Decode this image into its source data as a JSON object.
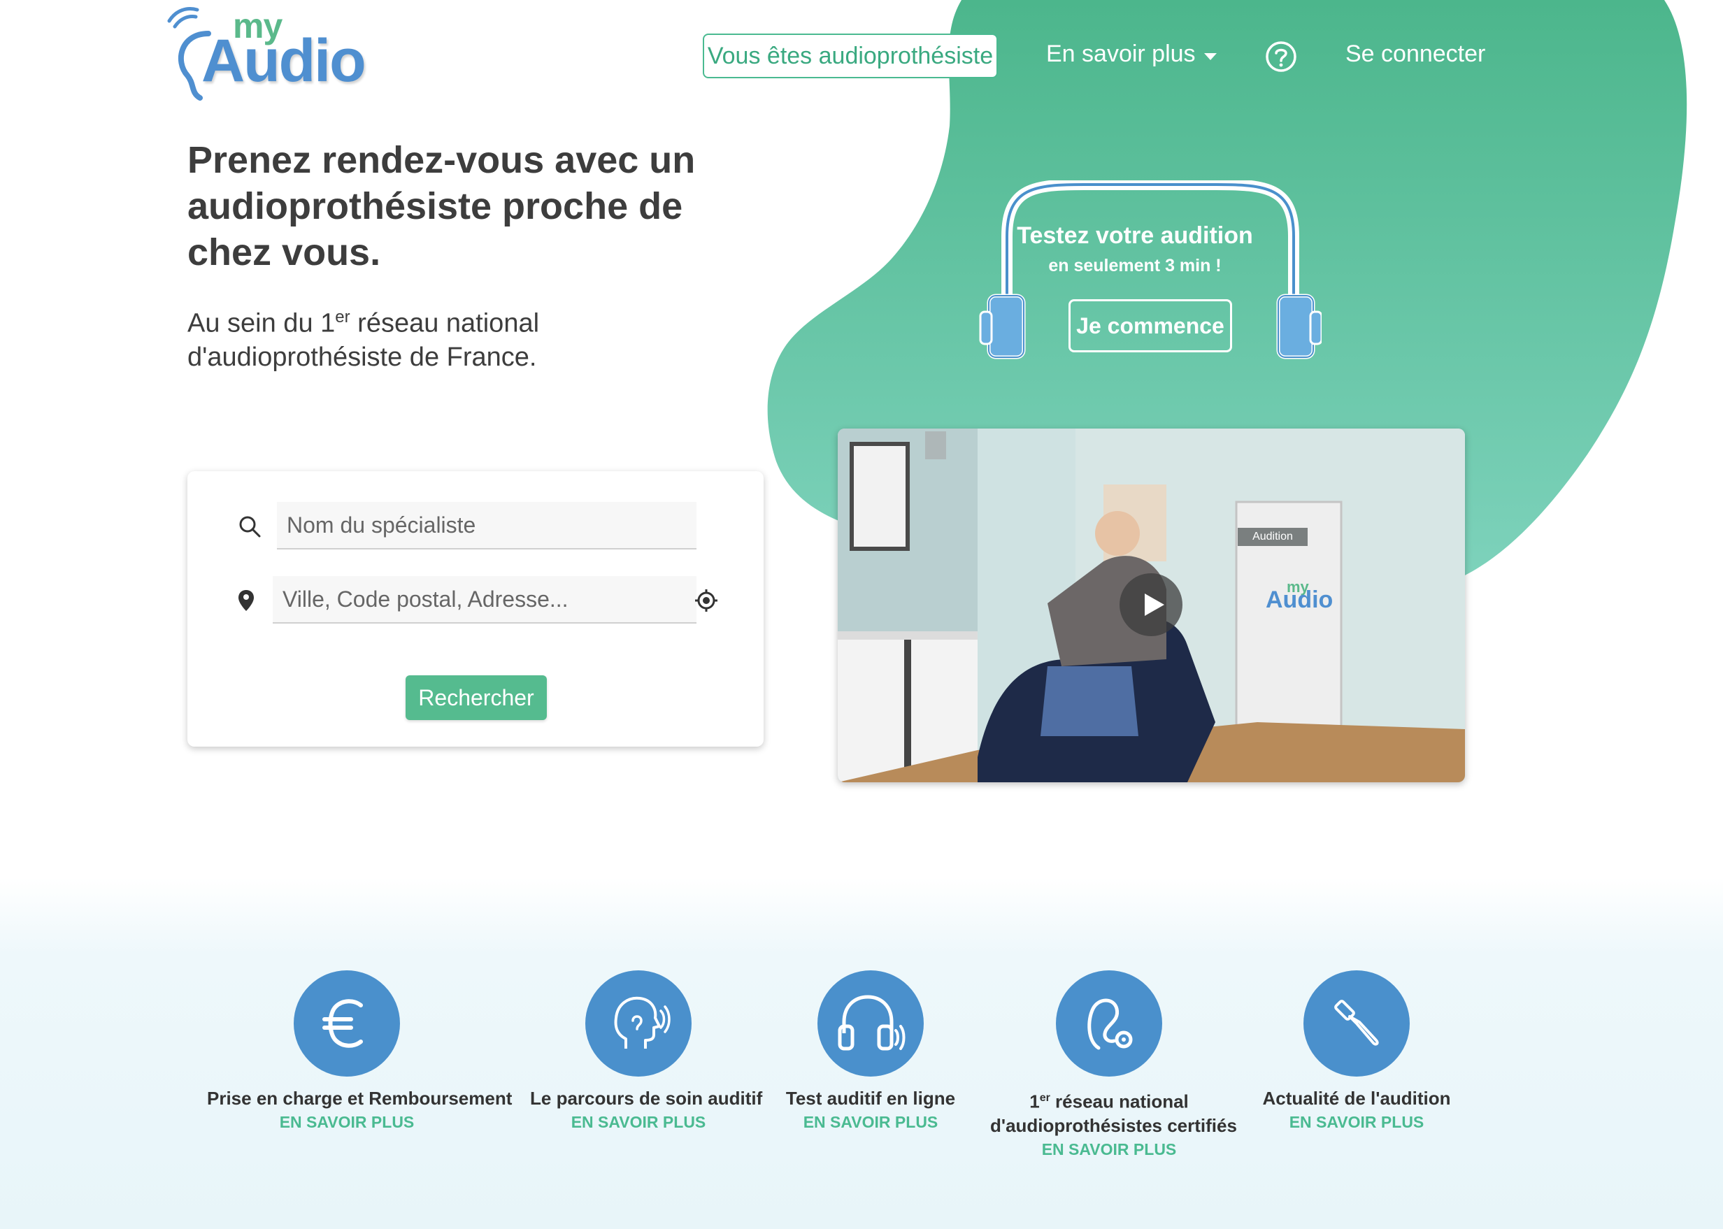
{
  "logo": {
    "my": "my",
    "audio": "Audio"
  },
  "nav": {
    "pro_label": "Vous êtes audioprothésiste",
    "savoir_label": "En savoir plus",
    "login_label": "Se connecter"
  },
  "hero": {
    "title": "Prenez rendez-vous avec un audioprothésiste proche de chez vous.",
    "subtitle_pre": "Au sein du 1",
    "subtitle_sup": "er",
    "subtitle_post": " réseau national d'audioprothésiste de France."
  },
  "search": {
    "name_placeholder": "Nom du spécialiste",
    "city_placeholder": "Ville, Code postal, Adresse...",
    "button_label": "Rechercher"
  },
  "test": {
    "title": "Testez votre audition",
    "subtitle": "en seulement 3 min !",
    "button_label": "Je commence"
  },
  "video": {
    "door_sign": "Audition",
    "door_logo_my": "my",
    "door_logo_audio": "Audio"
  },
  "features": [
    {
      "title": "Prise en charge et Remboursement",
      "link": "EN SAVOIR PLUS",
      "icon": "euro-icon"
    },
    {
      "title": "Le parcours de soin auditif",
      "link": "EN SAVOIR PLUS",
      "icon": "head-sound-icon"
    },
    {
      "title": "Test auditif en ligne",
      "link": "EN SAVOIR PLUS",
      "icon": "headphones-icon"
    },
    {
      "title_pre": "1",
      "title_sup": "er",
      "title_line1": " réseau national",
      "title_line2": "d'audioprothésistes certifiés",
      "link": "EN SAVOIR PLUS",
      "icon": "hearing-aid-icon"
    },
    {
      "title": "Actualité de l'audition",
      "link": "EN SAVOIR PLUS",
      "icon": "gavel-icon"
    }
  ],
  "colors": {
    "green": "#55bb8f",
    "blue": "#4a90cc",
    "text": "#3d3d3d"
  }
}
